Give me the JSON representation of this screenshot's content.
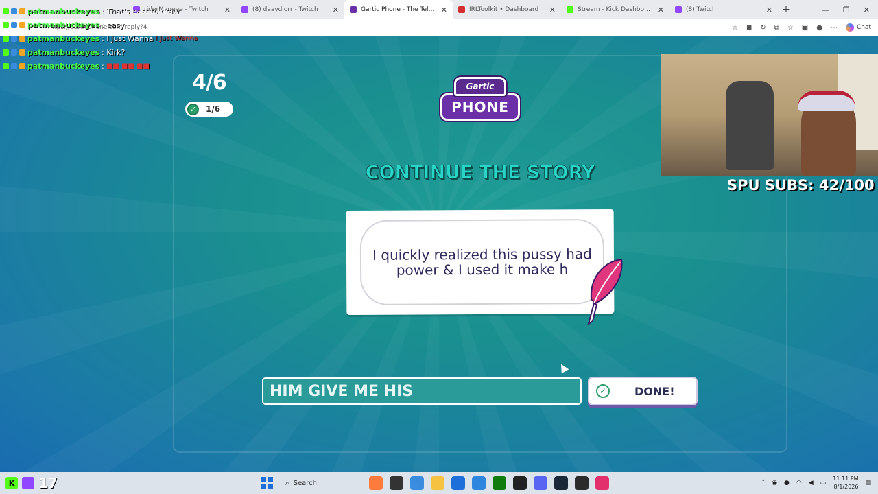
{
  "browser": {
    "tabs": [
      {
        "label": "riderManeee - Twitch",
        "color": "#9146ff"
      },
      {
        "label": "(8) daaydiorr - Twitch",
        "color": "#9146ff"
      },
      {
        "label": "Gartic Phone - The Telephone",
        "color": "#6b2fa8",
        "active": true
      },
      {
        "label": "IRLToolkit • Dashboard",
        "color": "#d32f2f"
      },
      {
        "label": "Stream - Kick Dashboard",
        "color": "#53fc18"
      },
      {
        "label": "(8) Twitch",
        "color": "#9146ff"
      }
    ],
    "url": "https://garticphone.com/reply?4",
    "copilot_label": "Chat"
  },
  "chat": [
    {
      "user": "patmanbuckeyes",
      "message": ": That's east to draw"
    },
    {
      "user": "patmanbuckeyes",
      "message": ": easy"
    },
    {
      "user": "patmanbuckeyes",
      "message": ": I Just Wanna",
      "emote": "I Just Wanna"
    },
    {
      "user": "patmanbuckeyes",
      "message": ": Kirk?"
    },
    {
      "user": "patmanbuckeyes",
      "message": ":",
      "emote": "■■ ■■ ■■"
    }
  ],
  "game": {
    "round": "4/6",
    "done_count": "1/6",
    "logo_top": "Gartic",
    "logo_main": "PHONE",
    "heading": "CONTINUE THE STORY",
    "story_text": "I quickly realized this pussy had power & I used it make h",
    "answer_value": "HIM GIVE ME HIS",
    "done_button": "DONE!"
  },
  "overlay": {
    "subs_label": "SPU SUBS: 42/100"
  },
  "taskbar": {
    "viewer_count": "17",
    "search_label": "Search",
    "time": "11:11 PM",
    "date": "8/1/2026",
    "app_colors": [
      "#ff7a3d",
      "#333333",
      "#3a8dde",
      "#f5c242",
      "#1e6fd9",
      "#2e86de",
      "#107c10",
      "#222222",
      "#5865f2",
      "#1b2838",
      "#2b2b2b",
      "#e1306c"
    ]
  },
  "colors": {
    "heading_fill": "#27d6c7",
    "chat_username": "#4cff4c",
    "game_bg": "#1f9c96",
    "logo_purple": "#6b2fa8"
  }
}
